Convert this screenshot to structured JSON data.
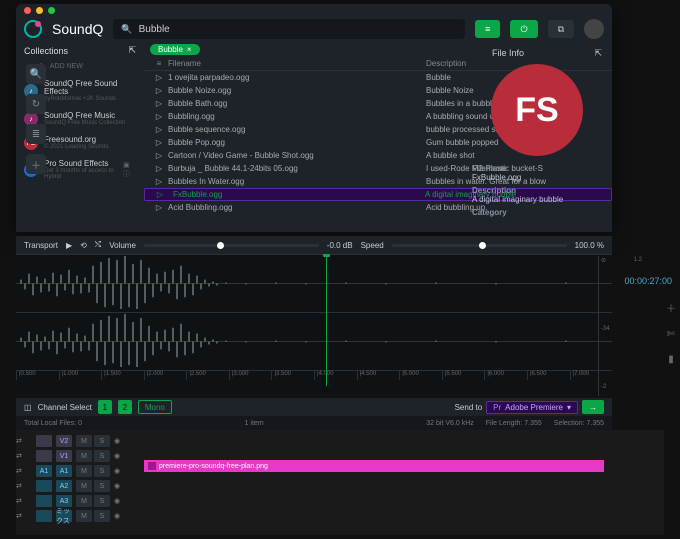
{
  "app": {
    "name": "SoundQ"
  },
  "search": {
    "query": "Bubble"
  },
  "sidebar": {
    "heading": "Collections",
    "add": "ADD NEW",
    "items": [
      {
        "name": "SoundQ Free Sound Effects",
        "sub": "byRobMorrow +2K Sounds",
        "color": "#2a6a8a"
      },
      {
        "name": "SoundQ Free Music",
        "sub": "SoundQ Free Music Collection",
        "color": "#8a2a6a"
      },
      {
        "name": "Freesound.org",
        "sub": "© 2021 Loading Sounds",
        "color": "#b92d3a",
        "badge": "FS"
      },
      {
        "name": "Pro Sound Effects",
        "sub": "Get 3 months of access to Hybrid",
        "color": "#1a6ad0",
        "badge": ">",
        "tag": "▣ ⓘ"
      }
    ]
  },
  "filter": {
    "label": "Bubble"
  },
  "cols": {
    "filename": "Filename",
    "description": "Description"
  },
  "rows": [
    {
      "f": "1 ovejita parpadeo.ogg",
      "d": "Bubble"
    },
    {
      "f": "Bubble Noize.ogg",
      "d": "Bubble Noize"
    },
    {
      "f": "Bubble Bath.ogg",
      "d": "Bubbles in a bubble bath. Record"
    },
    {
      "f": "Bubbling.ogg",
      "d": "A bubbling sound which makes a"
    },
    {
      "f": "Bubble sequence.ogg",
      "d": "bubble processed sample into a r"
    },
    {
      "f": "Bubble Pop.ogg",
      "d": "Gum bubble popped"
    },
    {
      "f": "Cartoon / Video Game - Bubble Shot.ogg",
      "d": "A bubble shot"
    },
    {
      "f": "Burbuja _ Bubble 44.1-24bits 05.ogg",
      "d": "I used-Rode M2-Plastic bucket-S"
    },
    {
      "f": "Bubbles In Water.ogg",
      "d": "Bubbles in water. Great for a blow"
    },
    {
      "f": "FxBubble.ogg",
      "d": "A digital imaginary bubble",
      "sel": true
    },
    {
      "f": "Acid Bubbling.ogg",
      "d": "Acid bubbling up."
    }
  ],
  "fileInfo": {
    "heading": "File Info",
    "badge": "FS",
    "labels": {
      "filename": "Filename",
      "description": "Description",
      "category": "Category"
    },
    "filename": "FxBubble.ogg",
    "description": "A digital imaginary bubble"
  },
  "transport": {
    "label": "Transport",
    "volume_label": "Volume",
    "volume_value": "-0.0 dB",
    "speed_label": "Speed",
    "speed_value": "100.0 %"
  },
  "ruler": [
    "|0.500",
    "|1.000",
    "|1.500",
    "|2.000",
    "|2.500",
    "|3.000",
    "|3.500",
    "|4.000",
    "|4.500",
    "|5.000",
    "|5.500",
    "|6.000",
    "|6.500",
    "|7.000"
  ],
  "mini": {
    "a": "1.2",
    "b": "-34",
    "c": "-2"
  },
  "channel": {
    "label": "Channel Select",
    "ch1": "1",
    "ch2": "2",
    "mono": "Mono"
  },
  "sendto": {
    "label": "Send to",
    "target": "Adobe Premiere"
  },
  "status": {
    "local": "Total Local Files: 0",
    "items": "1 item",
    "format": "32 bit V6.0 kHz",
    "length": "File Length: 7.355",
    "selection": "Selection: 7.355"
  },
  "host": {
    "timecode": "00:00:27:00",
    "clip": "premiere-pro-soundq-free-plan.png",
    "tracks": [
      {
        "k": "v",
        "l": "",
        "n": "V2"
      },
      {
        "k": "v",
        "l": "",
        "n": "V1"
      },
      {
        "k": "a",
        "l": "A1",
        "n": "A1"
      },
      {
        "k": "a",
        "l": "",
        "n": "A2"
      },
      {
        "k": "a",
        "l": "",
        "n": "A3"
      },
      {
        "k": "a",
        "l": "",
        "n": "ミックス"
      }
    ]
  }
}
